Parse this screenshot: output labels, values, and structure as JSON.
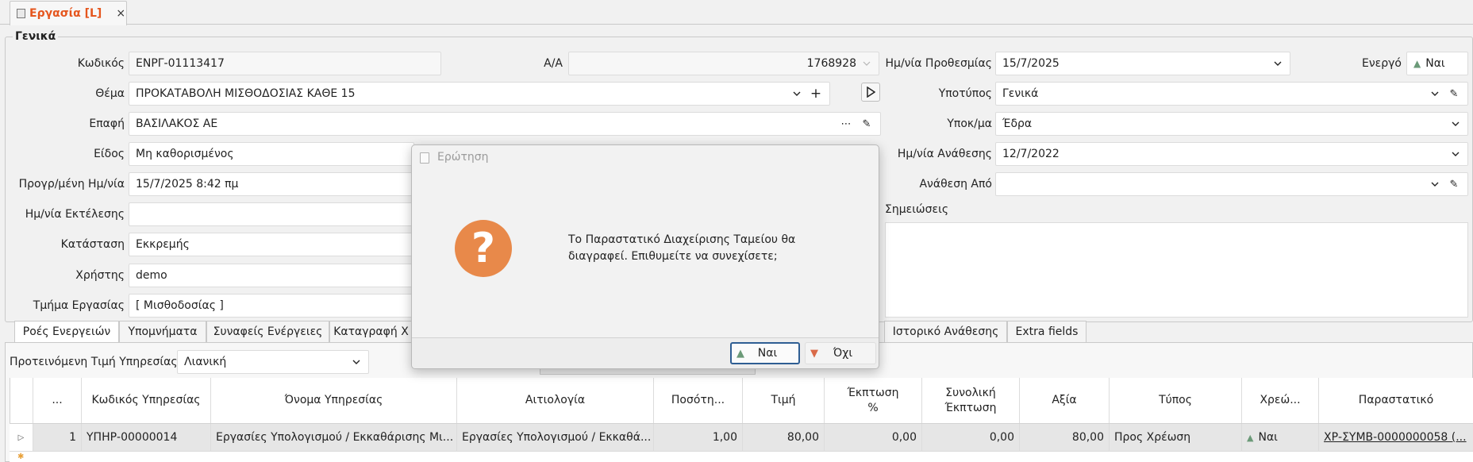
{
  "doc_tab": {
    "title": "Εργασία [L]",
    "close": "×"
  },
  "group": {
    "title": "Γενικά"
  },
  "left_form": {
    "code_label": "Κωδικός",
    "code_value": "ΕΝΡΓ-01113417",
    "aa_label": "Α/Α",
    "aa_value": "1768928",
    "subject_label": "Θέμα",
    "subject_value": "ΠΡΟΚΑΤΑΒΟΛΗ ΜΙΣΘΟΔΟΣΙΑΣ ΚΑΘΕ 15",
    "contact_label": "Επαφή",
    "contact_value": "ΒΑΣΙΛΑΚΟΣ ΑΕ",
    "kind_label": "Είδος",
    "kind_value": "Μη καθορισμένος",
    "scheduled_label": "Προγρ/μένη Ημ/νία",
    "scheduled_value": "15/7/2025 8:42 πμ",
    "executed_label": "Ημ/νία Εκτέλεσης",
    "executed_value": "",
    "status_label": "Κατάσταση",
    "status_value": "Εκκρεμής",
    "user_label": "Χρήστης",
    "user_value": "demo",
    "dept_label": "Τμήμα Εργασίας",
    "dept_value": "[ Μισθοδοσίας ]"
  },
  "right_form": {
    "deadline_label": "Ημ/νία Προθεσμίας",
    "deadline_value": "15/7/2025",
    "active_label": "Ενεργό",
    "active_value": "Ναι",
    "subtype_label": "Υποτύπος",
    "subtype_value": "Γενικά",
    "branch_label": "Υποκ/μα",
    "branch_value": "Έδρα",
    "assign_date_label": "Ημ/νία Ανάθεσης",
    "assign_date_value": "12/7/2022",
    "assign_from_label": "Ανάθεση Από",
    "assign_from_value": "",
    "notes_label": "Σημειώσεις"
  },
  "tabs": [
    "Ροές Ενεργειών",
    "Υπομνήματα",
    "Συναφείς Ενέργειες",
    "Καταγραφή Χ",
    "Ιστορικό Ανάθεσης",
    "Extra fields"
  ],
  "pricing": {
    "label": "Προτεινόμενη Τιμή Υπηρεσίας",
    "value": "Λιανική"
  },
  "grid": {
    "headers": [
      "...",
      "Κωδικός Υπηρεσίας",
      "Όνομα Υπηρεσίας",
      "Αιτιολογία",
      "Ποσότη...",
      "Τιμή",
      "Έκπτωση %",
      "Συνολική Έκπτωση",
      "Αξία",
      "Τύπος",
      "Χρεώ...",
      "Παραστατικό"
    ],
    "rows": [
      [
        "1",
        "ΥΠΗΡ-00000014",
        "Εργασίες Υπολογισμού / Εκκαθάρισης Μι...",
        "Εργασίες Υπολογισμού / Εκκαθά...",
        "1,00",
        "80,00",
        "0,00",
        "0,00",
        "80,00",
        "Προς Χρέωση",
        "Ναι",
        "ΧΡ-ΣΥΜΒ-0000000058 (..."
      ]
    ]
  },
  "dialog": {
    "title": "Ερώτηση",
    "icon": "question-icon",
    "message": "Το Παραστατικό Διαχείρισης Ταμείου θα διαγραφεί. Επιθυμείτε να συνεχίσετε;",
    "yes_label": "Ναι",
    "no_label": "Όχι"
  },
  "colors": {
    "accent": "#e5561e",
    "question": "#e8894a",
    "focus": "#2f5e93"
  }
}
